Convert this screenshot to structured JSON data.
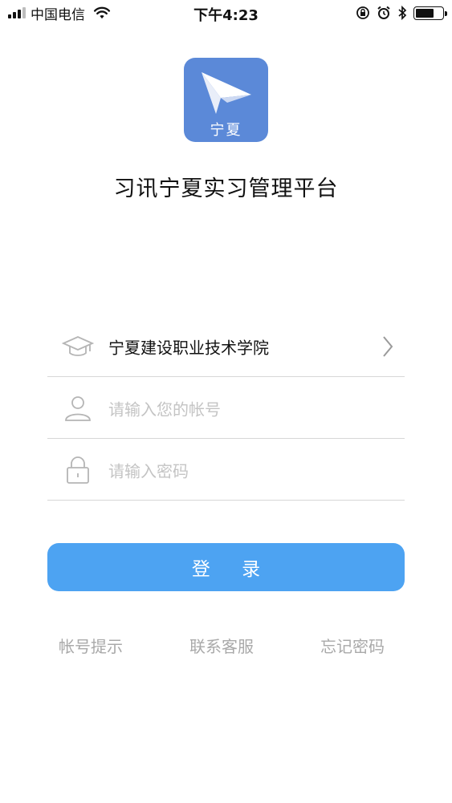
{
  "status_bar": {
    "carrier": "中国电信",
    "time": "下午4:23",
    "battery_level": 0.7
  },
  "logo": {
    "text": "宁夏",
    "color": "#5b89d8"
  },
  "app_title": "习讯宁夏实习管理平台",
  "form": {
    "school": "宁夏建设职业技术学院",
    "account_placeholder": "请输入您的帐号",
    "password_placeholder": "请输入密码"
  },
  "login_button": {
    "label": "登 录",
    "color": "#4da3f2"
  },
  "links": {
    "account_hint": "帐号提示",
    "contact_service": "联系客服",
    "forgot_password": "忘记密码"
  }
}
